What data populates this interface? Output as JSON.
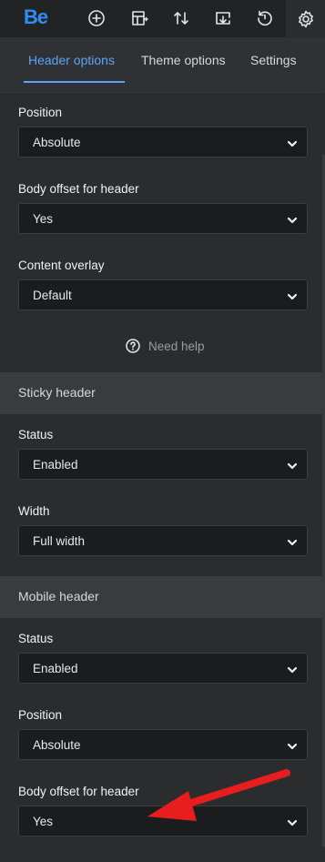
{
  "toolbar": {
    "logo": "Be",
    "icons": [
      "add-icon",
      "layout-add-icon",
      "sort-icon",
      "export-icon",
      "history-icon",
      "gear-icon"
    ]
  },
  "tabs": [
    {
      "label": "Header options",
      "active": true
    },
    {
      "label": "Theme options",
      "active": false
    },
    {
      "label": "Settings",
      "active": false
    }
  ],
  "header_options": {
    "position": {
      "label": "Position",
      "value": "Absolute"
    },
    "body_offset": {
      "label": "Body offset for header",
      "value": "Yes"
    },
    "content_overlay": {
      "label": "Content overlay",
      "value": "Default"
    },
    "help": "Need help"
  },
  "sticky_header": {
    "title": "Sticky header",
    "status": {
      "label": "Status",
      "value": "Enabled"
    },
    "width": {
      "label": "Width",
      "value": "Full width"
    }
  },
  "mobile_header": {
    "title": "Mobile header",
    "status": {
      "label": "Status",
      "value": "Enabled"
    },
    "position": {
      "label": "Position",
      "value": "Absolute"
    },
    "body_offset": {
      "label": "Body offset for header",
      "value": "Yes"
    }
  },
  "colors": {
    "accent": "#5aa4f5",
    "logo": "#2f8df5",
    "annotation_arrow": "#e81e1e"
  }
}
